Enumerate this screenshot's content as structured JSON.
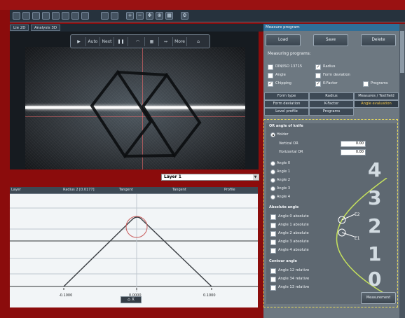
{
  "app": {
    "title": "",
    "tabs": [
      {
        "label": "Lie 2D",
        "active": true
      },
      {
        "label": "Analysis 3D",
        "active": false
      }
    ],
    "toolbar_icons": [
      "zoom-in-icon",
      "zoom-out-icon",
      "move-icon",
      "target-icon",
      "grid-icon",
      "settings-icon"
    ]
  },
  "camera_controls": {
    "play": "▶",
    "auto": "Auto",
    "next": "Next",
    "pause": "❚❚",
    "arc": "◠",
    "grid": "▦",
    "fit": "↔",
    "more": "More",
    "home": "⌂"
  },
  "layer_select": {
    "value": "Layer 1"
  },
  "profile_header": {
    "labels": [
      "Layer",
      "Radius 2 [0.0177]",
      "Tangent",
      "Tangent",
      "Profile"
    ]
  },
  "profile_plot": {
    "ticks": [
      "-0.1000",
      "0.0000",
      "0.1000"
    ],
    "tool_label": "⌂ X"
  },
  "right_panel": {
    "title": "Measure program",
    "buttons": [
      "Load",
      "Save",
      "Delete"
    ],
    "measuring_programs_label": "Measuring programs:",
    "checkboxes": [
      {
        "label": "DIN/ISO 13715",
        "checked": false
      },
      {
        "label": "Radius",
        "checked": true
      },
      {
        "label": "Angle",
        "checked": false
      },
      {
        "label": "Form deviation",
        "checked": false
      },
      {
        "label": "Chipping",
        "checked": true
      },
      {
        "label": "K-Factor",
        "checked": true
      },
      {
        "label": "Programs",
        "checked": false
      }
    ],
    "grid_buttons": [
      {
        "label": "Form type",
        "active": false
      },
      {
        "label": "Radius",
        "active": false
      },
      {
        "label": "Measures / Textfield",
        "active": false
      },
      {
        "label": "Form deviation",
        "active": false
      },
      {
        "label": "K-Factor",
        "active": false
      },
      {
        "label": "Angle evaluation",
        "active": true
      },
      {
        "label": "Level profile",
        "active": false
      },
      {
        "label": "Programs",
        "active": false
      }
    ],
    "inner": {
      "section_title": "OR angle of knife",
      "holder_label": "Holder",
      "vertical_label": "Vertical OR",
      "vertical_value": "0.00",
      "horizontal_label": "Horizontal OR",
      "horizontal_value": "0.00",
      "angle_radios": [
        "Angle 0",
        "Angle 1",
        "Angle 2",
        "Angle 3",
        "Angle 4"
      ],
      "absolute_title": "Absolute angle",
      "absolute_checks": [
        "Angle 0 absolute",
        "Angle 1 absolute",
        "Angle 2 absolute",
        "Angle 3 absolute",
        "Angle 4 absolute"
      ],
      "contour_title": "Contour angle",
      "contour_checks": [
        "Angle 12 relative",
        "Angle 34 relative",
        "Angle 13 relative"
      ],
      "diagram_numbers": [
        "4",
        "3",
        "2",
        "1",
        "0"
      ],
      "diagram_labels": [
        "E2",
        "E1"
      ],
      "measurement_button": "Measurement"
    }
  }
}
